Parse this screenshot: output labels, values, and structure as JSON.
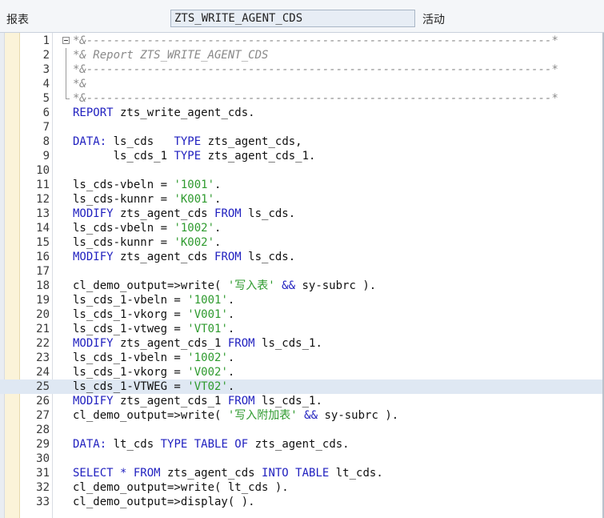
{
  "header": {
    "report_label": "报表",
    "program_name": "ZTS_WRITE_AGENT_CDS",
    "status": "活动"
  },
  "editor": {
    "highlighted_line": 25,
    "lines": [
      {
        "num": "1",
        "fold": "start",
        "tokens": [
          {
            "t": "com",
            "v": "*&---------------------------------------------------------------------*"
          }
        ]
      },
      {
        "num": "2",
        "fold": "mid",
        "tokens": [
          {
            "t": "com",
            "v": "*& Report ZTS_WRITE_AGENT_CDS"
          }
        ]
      },
      {
        "num": "3",
        "fold": "mid",
        "tokens": [
          {
            "t": "com",
            "v": "*&---------------------------------------------------------------------*"
          }
        ]
      },
      {
        "num": "4",
        "fold": "mid",
        "tokens": [
          {
            "t": "com",
            "v": "*&"
          }
        ]
      },
      {
        "num": "5",
        "fold": "end",
        "tokens": [
          {
            "t": "com",
            "v": "*&---------------------------------------------------------------------*"
          }
        ]
      },
      {
        "num": "6",
        "tokens": [
          {
            "t": "kw",
            "v": "REPORT"
          },
          {
            "t": "id",
            "v": " zts_write_agent_cds."
          }
        ]
      },
      {
        "num": "7",
        "tokens": []
      },
      {
        "num": "8",
        "tokens": [
          {
            "t": "kw",
            "v": "DATA:"
          },
          {
            "t": "id",
            "v": " ls_cds   "
          },
          {
            "t": "kw",
            "v": "TYPE"
          },
          {
            "t": "id",
            "v": " zts_agent_cds,"
          }
        ]
      },
      {
        "num": "9",
        "tokens": [
          {
            "t": "id",
            "v": "      ls_cds_1 "
          },
          {
            "t": "kw",
            "v": "TYPE"
          },
          {
            "t": "id",
            "v": " zts_agent_cds_1."
          }
        ]
      },
      {
        "num": "10",
        "tokens": []
      },
      {
        "num": "11",
        "tokens": [
          {
            "t": "id",
            "v": "ls_cds-vbeln = "
          },
          {
            "t": "str",
            "v": "'1001'"
          },
          {
            "t": "id",
            "v": "."
          }
        ]
      },
      {
        "num": "12",
        "tokens": [
          {
            "t": "id",
            "v": "ls_cds-kunnr = "
          },
          {
            "t": "str",
            "v": "'K001'"
          },
          {
            "t": "id",
            "v": "."
          }
        ]
      },
      {
        "num": "13",
        "tokens": [
          {
            "t": "kw",
            "v": "MODIFY"
          },
          {
            "t": "id",
            "v": " zts_agent_cds "
          },
          {
            "t": "kw",
            "v": "FROM"
          },
          {
            "t": "id",
            "v": " ls_cds."
          }
        ]
      },
      {
        "num": "14",
        "tokens": [
          {
            "t": "id",
            "v": "ls_cds-vbeln = "
          },
          {
            "t": "str",
            "v": "'1002'"
          },
          {
            "t": "id",
            "v": "."
          }
        ]
      },
      {
        "num": "15",
        "tokens": [
          {
            "t": "id",
            "v": "ls_cds-kunnr = "
          },
          {
            "t": "str",
            "v": "'K002'"
          },
          {
            "t": "id",
            "v": "."
          }
        ]
      },
      {
        "num": "16",
        "tokens": [
          {
            "t": "kw",
            "v": "MODIFY"
          },
          {
            "t": "id",
            "v": " zts_agent_cds "
          },
          {
            "t": "kw",
            "v": "FROM"
          },
          {
            "t": "id",
            "v": " ls_cds."
          }
        ]
      },
      {
        "num": "17",
        "tokens": []
      },
      {
        "num": "18",
        "tokens": [
          {
            "t": "id",
            "v": "cl_demo_output=>write( "
          },
          {
            "t": "str",
            "v": "'写入表'"
          },
          {
            "t": "id",
            "v": " "
          },
          {
            "t": "kw",
            "v": "&&"
          },
          {
            "t": "id",
            "v": " sy-subrc )."
          }
        ]
      },
      {
        "num": "19",
        "tokens": [
          {
            "t": "id",
            "v": "ls_cds_1-vbeln = "
          },
          {
            "t": "str",
            "v": "'1001'"
          },
          {
            "t": "id",
            "v": "."
          }
        ]
      },
      {
        "num": "20",
        "tokens": [
          {
            "t": "id",
            "v": "ls_cds_1-vkorg = "
          },
          {
            "t": "str",
            "v": "'V001'"
          },
          {
            "t": "id",
            "v": "."
          }
        ]
      },
      {
        "num": "21",
        "tokens": [
          {
            "t": "id",
            "v": "ls_cds_1-vtweg = "
          },
          {
            "t": "str",
            "v": "'VT01'"
          },
          {
            "t": "id",
            "v": "."
          }
        ]
      },
      {
        "num": "22",
        "tokens": [
          {
            "t": "kw",
            "v": "MODIFY"
          },
          {
            "t": "id",
            "v": " zts_agent_cds_1 "
          },
          {
            "t": "kw",
            "v": "FROM"
          },
          {
            "t": "id",
            "v": " ls_cds_1."
          }
        ]
      },
      {
        "num": "23",
        "tokens": [
          {
            "t": "id",
            "v": "ls_cds_1-vbeln = "
          },
          {
            "t": "str",
            "v": "'1002'"
          },
          {
            "t": "id",
            "v": "."
          }
        ]
      },
      {
        "num": "24",
        "tokens": [
          {
            "t": "id",
            "v": "ls_cds_1-vkorg = "
          },
          {
            "t": "str",
            "v": "'V002'"
          },
          {
            "t": "id",
            "v": "."
          }
        ]
      },
      {
        "num": "25",
        "tokens": [
          {
            "t": "id",
            "v": "ls_cds_1-VTWEG = "
          },
          {
            "t": "str",
            "v": "'VT02'"
          },
          {
            "t": "id",
            "v": "."
          }
        ]
      },
      {
        "num": "26",
        "tokens": [
          {
            "t": "kw",
            "v": "MODIFY"
          },
          {
            "t": "id",
            "v": " zts_agent_cds_1 "
          },
          {
            "t": "kw",
            "v": "FROM"
          },
          {
            "t": "id",
            "v": " ls_cds_1."
          }
        ]
      },
      {
        "num": "27",
        "tokens": [
          {
            "t": "id",
            "v": "cl_demo_output=>write( "
          },
          {
            "t": "str",
            "v": "'写入附加表'"
          },
          {
            "t": "id",
            "v": " "
          },
          {
            "t": "kw",
            "v": "&&"
          },
          {
            "t": "id",
            "v": " sy-subrc )."
          }
        ]
      },
      {
        "num": "28",
        "tokens": []
      },
      {
        "num": "29",
        "tokens": [
          {
            "t": "kw",
            "v": "DATA:"
          },
          {
            "t": "id",
            "v": " lt_cds "
          },
          {
            "t": "kw",
            "v": "TYPE TABLE OF"
          },
          {
            "t": "id",
            "v": " zts_agent_cds."
          }
        ]
      },
      {
        "num": "30",
        "tokens": []
      },
      {
        "num": "31",
        "tokens": [
          {
            "t": "kw",
            "v": "SELECT * FROM"
          },
          {
            "t": "id",
            "v": " zts_agent_cds "
          },
          {
            "t": "kw",
            "v": "INTO TABLE"
          },
          {
            "t": "id",
            "v": " lt_cds."
          }
        ]
      },
      {
        "num": "32",
        "tokens": [
          {
            "t": "id",
            "v": "cl_demo_output=>write( lt_cds )."
          }
        ]
      },
      {
        "num": "33",
        "tokens": [
          {
            "t": "id",
            "v": "cl_demo_output=>display( )."
          }
        ]
      }
    ]
  },
  "colors": {
    "keyword": "#1f1fbf",
    "string": "#2e9a2e",
    "comment": "#8a8a8a",
    "highlight": "#dfe8f3"
  }
}
